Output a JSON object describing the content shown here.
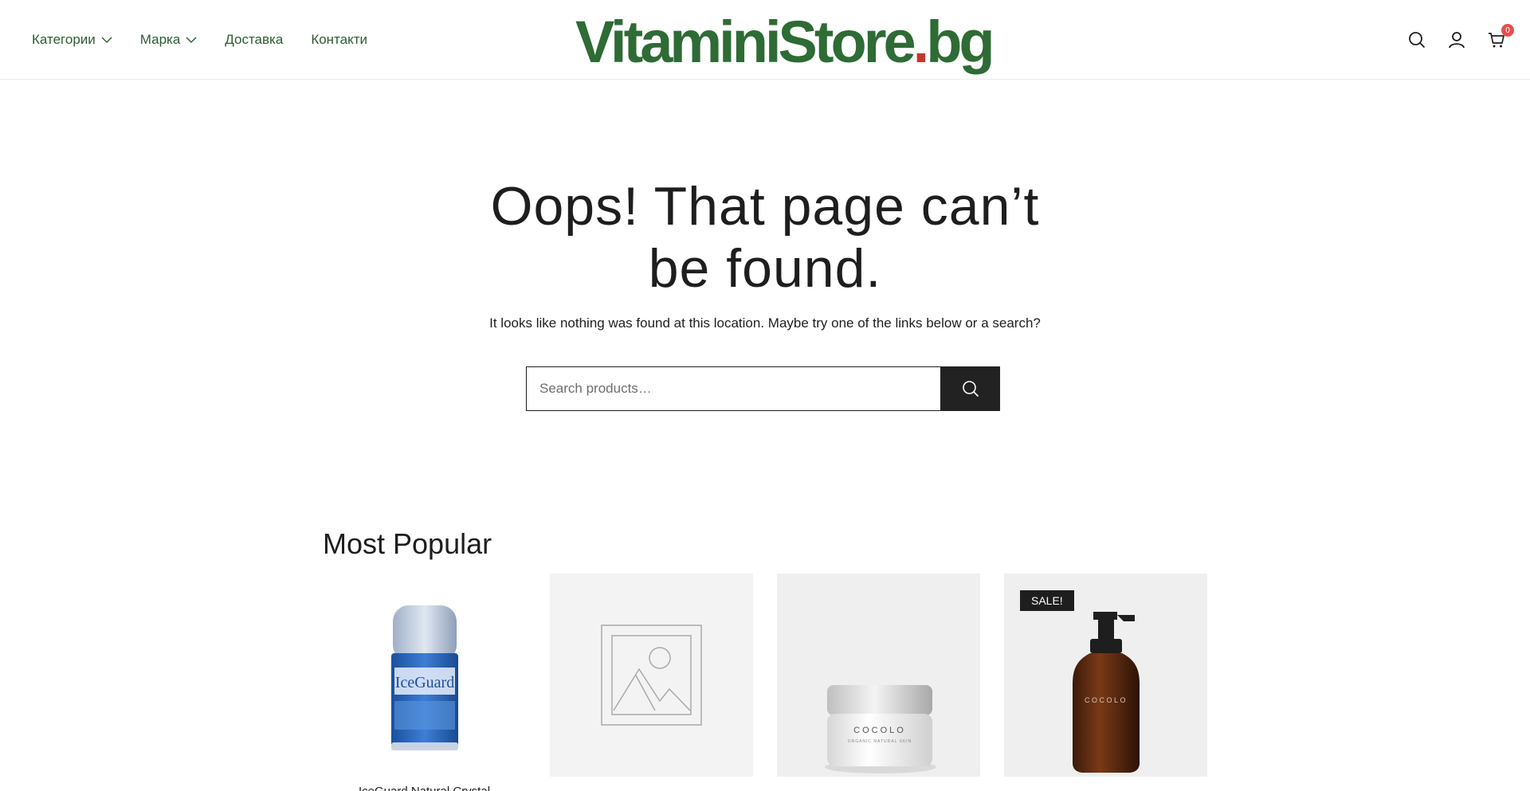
{
  "header": {
    "nav": [
      {
        "label": "Категории",
        "has_dropdown": true
      },
      {
        "label": "Марка",
        "has_dropdown": true
      },
      {
        "label": "Доставка",
        "has_dropdown": false
      },
      {
        "label": "Контакти",
        "has_dropdown": false
      }
    ],
    "logo_main": "VitaminiStore",
    "logo_dot": ".",
    "logo_tld": "bg",
    "icons": [
      "search-icon",
      "account-icon",
      "cart-icon"
    ],
    "cart_count": "0"
  },
  "main": {
    "title_line1": "Oops! That page can’t",
    "title_line2": "be found.",
    "subtitle": "It looks like nothing was found at this location. Maybe try one of the links below or a search?",
    "search_placeholder": "Search products…"
  },
  "popular": {
    "title": "Most Popular",
    "products": [
      {
        "name": "IceGuard Natural Crystal",
        "image": "deodorant-stick",
        "sale": false
      },
      {
        "name": "",
        "image": "placeholder",
        "sale": false
      },
      {
        "name": "",
        "image": "cream-jar",
        "sale": false
      },
      {
        "name": "",
        "image": "pump-bottle",
        "sale": true,
        "badge": "SALE!"
      }
    ]
  },
  "colors": {
    "brand_green": "#2e6b35",
    "nav_green": "#2b5d31",
    "logo_red": "#c0392b",
    "badge_red": "#e2504b",
    "dark": "#1e1e1e"
  }
}
